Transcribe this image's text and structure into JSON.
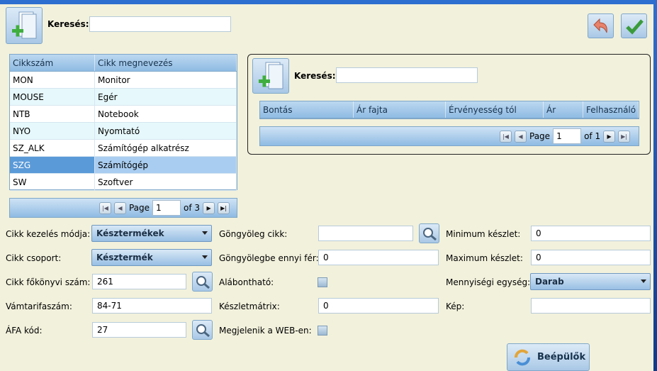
{
  "header": {
    "search_label": "Keresés:",
    "search_value": ""
  },
  "main_grid": {
    "columns": [
      "Cikkszám",
      "Cikk megnevezés"
    ],
    "rows": [
      {
        "code": "MON",
        "name": "Monitor"
      },
      {
        "code": "MOUSE",
        "name": "Egér"
      },
      {
        "code": "NTB",
        "name": "Notebook"
      },
      {
        "code": "NYO",
        "name": "Nyomtató"
      },
      {
        "code": "SZ_ALK",
        "name": "Számítógép alkatrész"
      },
      {
        "code": "SZG",
        "name": "Számítógép"
      },
      {
        "code": "SW",
        "name": "Szoftver"
      }
    ],
    "selected_index": 5
  },
  "main_pager": {
    "page_label": "Page",
    "page_value": "1",
    "of_label": "of 3"
  },
  "right_panel": {
    "search_label": "Keresés:",
    "search_value": "",
    "columns": [
      "Bontás",
      "Ár fajta",
      "Érvényesség tól",
      "Ár",
      "Felhasználó"
    ],
    "pager": {
      "page_label": "Page",
      "page_value": "1",
      "of_label": "of 1"
    }
  },
  "form": {
    "kezeles_label": "Cikk kezelés módja:",
    "kezeles_value": "Késztermékek",
    "csoport_label": "Cikk csoport:",
    "csoport_value": "Késztermék",
    "fokonyv_label": "Cikk főkönyvi szám:",
    "fokonyv_value": "261",
    "vamtarifa_label": "Vámtarifaszám:",
    "vamtarifa_value": "84-71",
    "afa_label": "ÁFA kód:",
    "afa_value": "27",
    "gongyoleg_label": "Göngyöleg cikk:",
    "gongyoleg_value": "",
    "gongyolegbe_label": "Göngyölegbe ennyi fér:",
    "gongyolegbe_value": "0",
    "alabonthato_label": "Alábontható:",
    "keszletmatrix_label": "Készletmátrix:",
    "keszletmatrix_value": "0",
    "web_label": "Megjelenik a WEB-en:",
    "min_label": "Minimum készlet:",
    "min_value": "0",
    "max_label": "Maximum készlet:",
    "max_value": "0",
    "egyseg_label": "Mennyiségi egység:",
    "egyseg_value": "Darab",
    "kep_label": "Kép:",
    "kep_value": ""
  },
  "plugins_button": {
    "label": "Beépülők"
  },
  "colors": {
    "accent": "#5b9ad8",
    "panel": "#f2f1dc",
    "header": "#8fbbe3"
  }
}
